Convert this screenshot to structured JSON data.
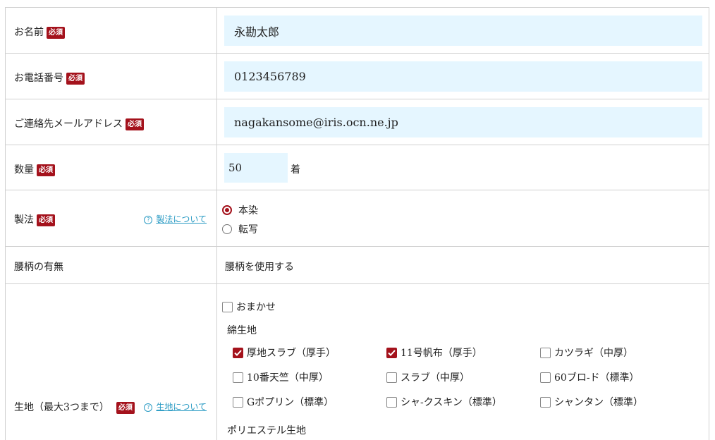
{
  "required_badge": "必須",
  "name": {
    "label": "お名前",
    "value": "永勘太郎"
  },
  "phone": {
    "label": "お電話番号",
    "value": "0123456789"
  },
  "email": {
    "label": "ご連絡先メールアドレス",
    "value": "nagakansome@iris.ocn.ne.jp"
  },
  "quantity": {
    "label": "数量",
    "value": "50",
    "unit": "着"
  },
  "method": {
    "label": "製法",
    "help_link": "製法について",
    "options": [
      {
        "label": "本染",
        "selected": true
      },
      {
        "label": "転写",
        "selected": false
      }
    ]
  },
  "waist_pattern": {
    "label": "腰柄の有無",
    "value": "腰柄を使用する"
  },
  "fabric": {
    "label": "生地（最大3つまで）",
    "help_link": "生地について",
    "omakase": {
      "label": "おまかせ",
      "checked": false
    },
    "groups": [
      {
        "title": "綿生地",
        "options": [
          {
            "label": "厚地スラブ（厚手）",
            "checked": true
          },
          {
            "label": "11号帆布（厚手）",
            "checked": true
          },
          {
            "label": "カツラギ（中厚）",
            "checked": false
          },
          {
            "label": "10番天竺（中厚）",
            "checked": false
          },
          {
            "label": "スラブ（中厚）",
            "checked": false
          },
          {
            "label": "60ブロ-ド（標準）",
            "checked": false
          },
          {
            "label": "Gポプリン（標準）",
            "checked": false
          },
          {
            "label": "シャ-クスキン（標準）",
            "checked": false
          },
          {
            "label": "シャンタン（標準）",
            "checked": false
          }
        ]
      },
      {
        "title": "ポリエステル生地"
      }
    ]
  },
  "colors": {
    "accent": "#a4121c",
    "input_bg": "#e5f6ff",
    "link": "#2a9bc4",
    "border": "#d0d0d0"
  }
}
